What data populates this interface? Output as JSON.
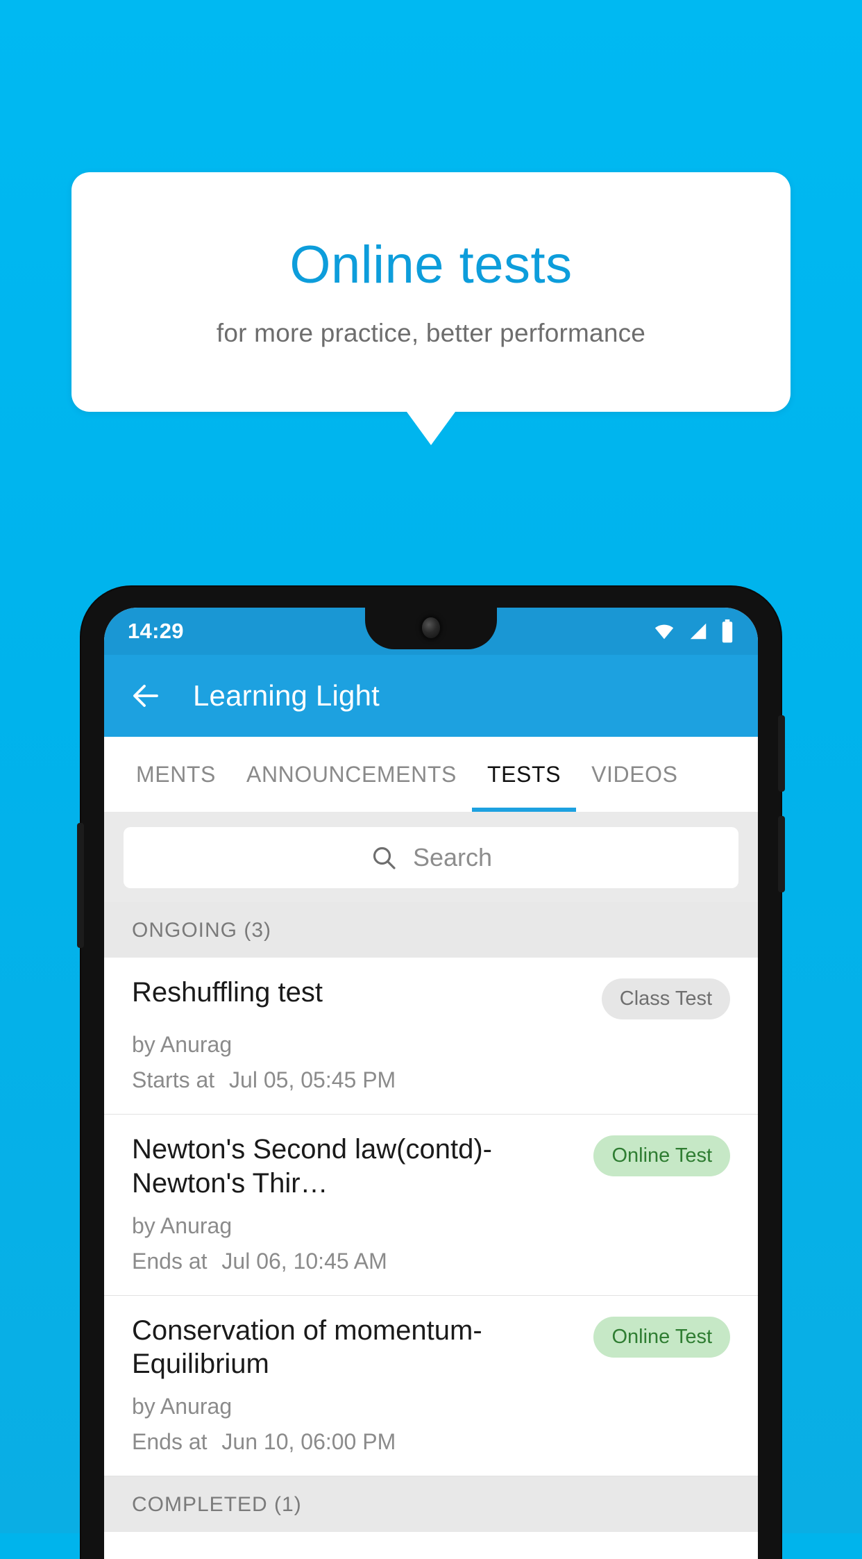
{
  "promo": {
    "title": "Online tests",
    "subtitle": "for more practice, better performance",
    "background_color": "#00b4ec",
    "title_color": "#0d9ddb"
  },
  "phone": {
    "status_bar": {
      "time": "14:29",
      "icons": [
        "wifi-icon",
        "signal-icon",
        "battery-icon"
      ]
    },
    "app_bar": {
      "back_label": "back-arrow-icon",
      "title": "Learning Light"
    },
    "tabs": [
      {
        "label": "MENTS",
        "active": false
      },
      {
        "label": "ANNOUNCEMENTS",
        "active": false
      },
      {
        "label": "TESTS",
        "active": true
      },
      {
        "label": "VIDEOS",
        "active": false
      }
    ],
    "search": {
      "placeholder": "Search",
      "value": "",
      "icon": "search-icon"
    },
    "sections": [
      {
        "header": "ONGOING (3)",
        "items": [
          {
            "title": "Reshuffling test",
            "badge": "Class Test",
            "badge_type": "class",
            "author": "by Anurag",
            "when_label": "Starts at",
            "when_value": "Jul 05, 05:45 PM"
          },
          {
            "title": "Newton's Second law(contd)-Newton's Thir…",
            "badge": "Online Test",
            "badge_type": "online",
            "author": "by Anurag",
            "when_label": "Ends at",
            "when_value": "Jul 06, 10:45 AM"
          },
          {
            "title": "Conservation of momentum-Equilibrium",
            "badge": "Online Test",
            "badge_type": "online",
            "author": "by Anurag",
            "when_label": "Ends at",
            "when_value": "Jun 10, 06:00 PM"
          }
        ]
      },
      {
        "header": "COMPLETED (1)",
        "items": []
      }
    ]
  },
  "colors": {
    "accent": "#1da1e0",
    "promo_bg": "#00b4ec",
    "badge_online_bg": "#c6e8c6",
    "badge_online_text": "#2f7d32",
    "badge_class_bg": "#e6e6e6",
    "badge_class_text": "#6f6f6f"
  }
}
